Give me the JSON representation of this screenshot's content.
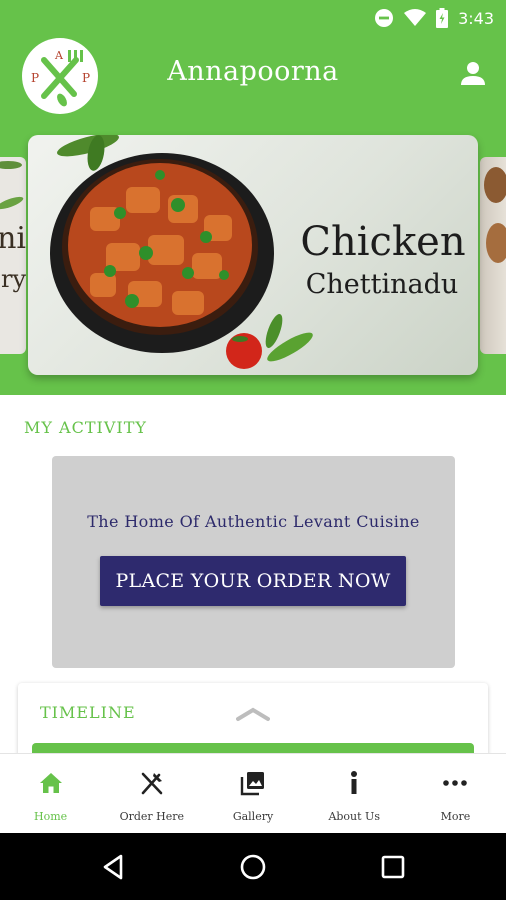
{
  "status_bar": {
    "time": "3:43"
  },
  "app_bar": {
    "title": "Annapoorna"
  },
  "banner": {
    "current_slide": {
      "title_line1": "Chicken",
      "title_line2": "Chettinadu"
    },
    "prev_slide_partial": {
      "line1": "ni",
      "line2": "ry"
    }
  },
  "activity": {
    "section_title": "MY ACTIVITY",
    "tagline": "The Home Of Authentic Levant Cuisine",
    "order_button": "PLACE YOUR ORDER NOW"
  },
  "timeline": {
    "title": "TIMELINE"
  },
  "bottom_nav": {
    "items": [
      {
        "label": "Home",
        "icon": "home-icon",
        "active": true
      },
      {
        "label": "Order Here",
        "icon": "fork-knife-icon",
        "active": false
      },
      {
        "label": "Gallery",
        "icon": "gallery-icon",
        "active": false
      },
      {
        "label": "About Us",
        "icon": "info-icon",
        "active": false
      },
      {
        "label": "More",
        "icon": "more-icon",
        "active": false
      }
    ]
  },
  "colors": {
    "brand_green": "#66c24a",
    "button_navy": "#2e2a6e",
    "card_grey": "#cfcfcf"
  }
}
